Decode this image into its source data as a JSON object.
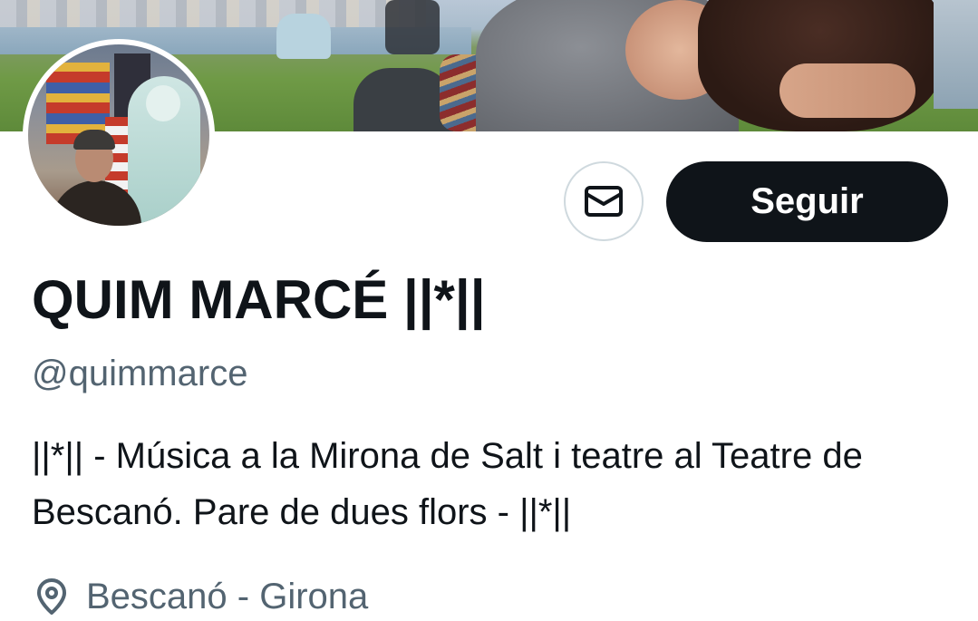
{
  "profile": {
    "display_name": "QUIM MARCÉ ||*||",
    "handle": "@quimmarce",
    "bio": "||*|| - Música a la Mirona de Salt i teatre al Teatre de Bescanó. Pare de dues flors - ||*||",
    "location": "Bescanó - Girona"
  },
  "actions": {
    "follow_label": "Seguir",
    "message_icon": "mail-icon"
  },
  "icons": {
    "location": "location-pin-icon"
  },
  "colors": {
    "text_primary": "#0f1419",
    "text_secondary": "#536471",
    "follow_button_bg": "#0f1419",
    "follow_button_text": "#ffffff",
    "border": "#cfd9de"
  }
}
